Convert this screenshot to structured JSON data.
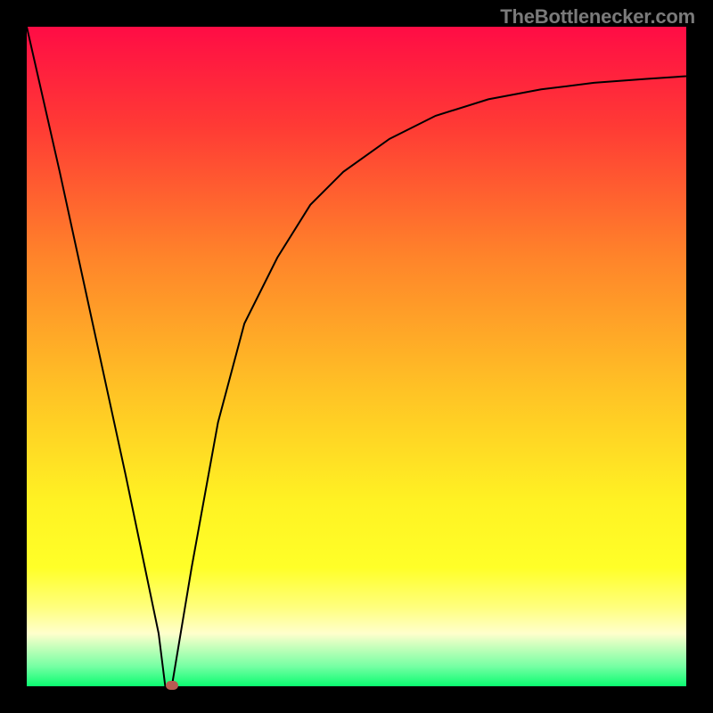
{
  "attribution": "TheBottlenecker.com",
  "chart_data": {
    "type": "line",
    "title": "",
    "xlabel": "",
    "ylabel": "",
    "xlim": [
      0,
      100
    ],
    "ylim": [
      0,
      100
    ],
    "series": [
      {
        "name": "curve",
        "x": [
          0,
          5,
          10,
          15,
          20,
          21,
          22,
          25,
          29,
          33,
          38,
          43,
          48,
          55,
          62,
          70,
          78,
          86,
          94,
          100
        ],
        "y": [
          100,
          78,
          55,
          32,
          8,
          0,
          0,
          18,
          40,
          55,
          65,
          73,
          78,
          83,
          86.5,
          89,
          90.5,
          91.5,
          92.1,
          92.5
        ],
        "color": "#000000"
      }
    ],
    "marker": {
      "x": 22,
      "y": 0,
      "color": "#b85a52"
    },
    "background_gradient": {
      "stops": [
        {
          "offset": 0.0,
          "color": "#ff0c45"
        },
        {
          "offset": 0.15,
          "color": "#ff3a35"
        },
        {
          "offset": 0.35,
          "color": "#ff842a"
        },
        {
          "offset": 0.55,
          "color": "#ffc225"
        },
        {
          "offset": 0.72,
          "color": "#fff223"
        },
        {
          "offset": 0.82,
          "color": "#ffff28"
        },
        {
          "offset": 0.88,
          "color": "#ffff7d"
        },
        {
          "offset": 0.92,
          "color": "#ffffcc"
        },
        {
          "offset": 0.97,
          "color": "#75ffa3"
        },
        {
          "offset": 1.0,
          "color": "#0bfc71"
        }
      ]
    }
  }
}
